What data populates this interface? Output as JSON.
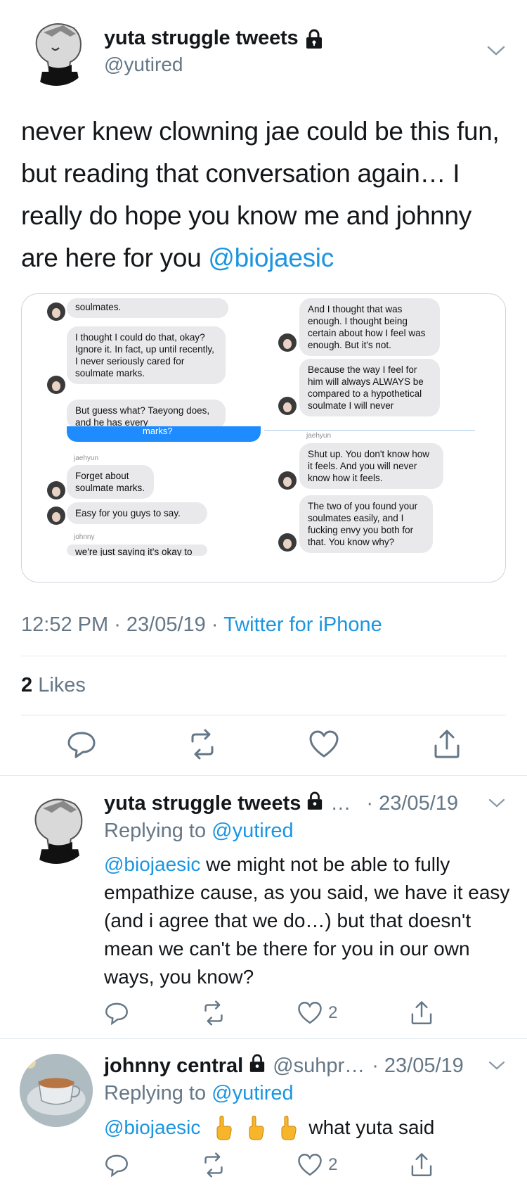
{
  "main_tweet": {
    "display_name": "yuta struggle tweets",
    "handle": "@yutired",
    "text_parts": [
      "never knew clowning jae could be this fun, but reading that conversation again… I really do hope you know me and johnny are here for you "
    ],
    "mention": "@biojaesic",
    "time": "12:52 PM",
    "date": "23/05/19",
    "source": "Twitter for iPhone",
    "likes_count": "2",
    "likes_label": "Likes"
  },
  "chat": {
    "left": {
      "b1": "soulmates.",
      "b2": "I thought I could do that, okay? Ignore it. In fact, up until recently, I never seriously cared for soulmate marks.",
      "b3": "But guess what? Taeyong does, and he has every",
      "b4": "marks?",
      "sender1": "jaehyun",
      "b5": "Forget about soulmate marks.",
      "b6": "Easy for you guys to say.",
      "sender2": "johnny",
      "b7": "we're just saying it's okay to"
    },
    "right": {
      "b1": "And I thought that was enough. I thought being certain about how I feel was enough. But it's not.",
      "b2": "Because the way I feel for him will always ALWAYS be compared to a hypothetical soulmate I will never",
      "sender1": "jaehyun",
      "b3": "Shut up. You don't know how it feels. And you will never know how it feels.",
      "b4": "The two of you found your soulmates easily, and I fucking envy you both for that. You know why?"
    }
  },
  "replies": [
    {
      "display_name": "yuta struggle tweets",
      "truncation": "…",
      "date": "· 23/05/19",
      "replying_label": "Replying to ",
      "replying_handle": "@yutired",
      "mention": "@biojaesic",
      "text": " we might not be able to fully empathize cause, as you said, we have it easy (and i agree that we do…) but that doesn't mean we can't be there for you in our own ways, you know?",
      "likes": "2"
    },
    {
      "display_name": "johnny central",
      "handle": "@suhpr…",
      "date": "· 23/05/19",
      "replying_label": "Replying to ",
      "replying_handle": "@yutired",
      "mention": "@biojaesic",
      "text": "what yuta said",
      "emojis": [
        "point-up-emoji",
        "point-up-emoji",
        "point-up-emoji"
      ],
      "likes": "2"
    }
  ],
  "colors": {
    "link": "#1b95e0",
    "secondary": "#657786",
    "divider": "#e1e8ed",
    "imessage_blue": "#1e8bff",
    "imessage_gray": "#e9e9eb"
  },
  "icons": [
    "reply-icon",
    "retweet-icon",
    "like-icon",
    "share-icon",
    "lock-icon",
    "chevron-down-icon"
  ]
}
